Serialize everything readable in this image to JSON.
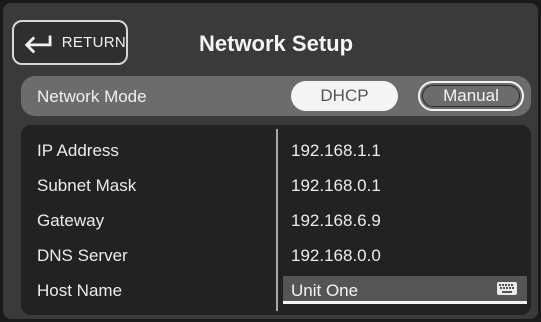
{
  "header": {
    "return_label": "RETURN",
    "title": "Network Setup"
  },
  "network_mode": {
    "label": "Network Mode",
    "options": [
      "DHCP",
      "Manual"
    ],
    "selected": "Manual"
  },
  "fields": [
    {
      "label": "IP Address",
      "value": "192.168.1.1"
    },
    {
      "label": "Subnet Mask",
      "value": "192.168.0.1"
    },
    {
      "label": "Gateway",
      "value": "192.168.6.9"
    },
    {
      "label": "DNS Server",
      "value": "192.168.0.0"
    },
    {
      "label": "Host Name",
      "value": "Unit One"
    }
  ],
  "icons": {
    "return": "return-arrow-icon",
    "keyboard": "keyboard-icon"
  },
  "colors": {
    "background": "#1a1a1a",
    "panel": "#3a3a3a",
    "mode_bar": "#6c6c6c",
    "table": "#222222",
    "text": "#ececec"
  }
}
